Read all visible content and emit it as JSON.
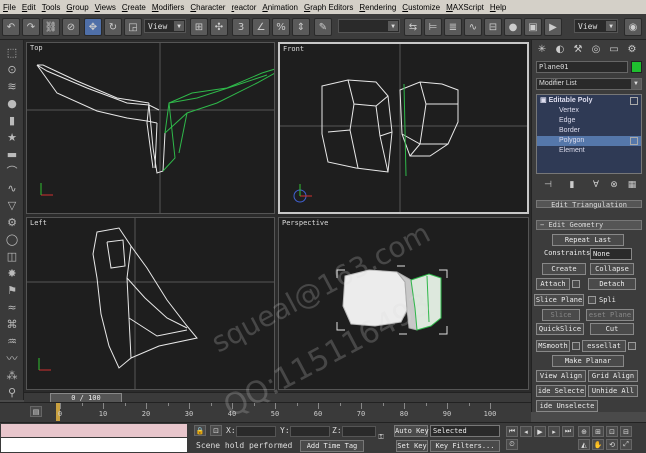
{
  "menu": [
    "File",
    "Edit",
    "Tools",
    "Group",
    "Views",
    "Create",
    "Modifiers",
    "Character",
    "reactor",
    "Animation",
    "Graph Editors",
    "Rendering",
    "Customize",
    "MAXScript",
    "Help"
  ],
  "toolbar": {
    "ref_coord": "View",
    "named_selection": "",
    "view2": "View"
  },
  "left_toolbar_icons": [
    "select-icon",
    "lathe-icon",
    "loft-icon",
    "sphere-icon",
    "cylinder-icon",
    "star-icon",
    "box-icon",
    "bend-icon",
    "wave-icon",
    "taper-icon",
    "gear-icon",
    "torus-icon",
    "camera-icon",
    "light-icon",
    "helper-icon",
    "space-warp-icon",
    "system-icon",
    "cloth-icon",
    "hair-icon",
    "particle-icon",
    "bone-icon"
  ],
  "viewports": {
    "top": "Top",
    "front": "Front",
    "left": "Left",
    "perspective": "Perspective"
  },
  "command_panel": {
    "object_name": "Plane01",
    "object_color": "#1fbf2f",
    "modifier_list": "Modifier List",
    "stack": {
      "root": "Editable Poly",
      "items": [
        "Vertex",
        "Edge",
        "Border",
        "Polygon",
        "Element"
      ],
      "selected": "Polygon"
    },
    "rollouts": {
      "edit_triangulation": "Edit Triangulation",
      "edit_geometry": "Edit Geometry"
    },
    "buttons": {
      "repeat_last": "Repeat Last",
      "constraints_label": "Constraints:",
      "constraints_value": "None",
      "create": "Create",
      "collapse": "Collapse",
      "attach": "Attach",
      "detach": "Detach",
      "slice_plane": "Slice Plane",
      "split": "Spli",
      "slice": "Slice",
      "reset_plane": "eset Plane",
      "quickslice": "QuickSlice",
      "cut": "Cut",
      "msmooth": "MSmooth",
      "tessellate": "essellat",
      "make_planar": "Make Planar",
      "view_align": "View Align",
      "grid_align": "Grid Align",
      "hide_selected": "ide Selecte",
      "unhide_all": "Unhide All",
      "hide_unselected": "ide Unselecte"
    }
  },
  "timeline": {
    "frame_display": "0 / 100",
    "ticks": [
      "0",
      "10",
      "20",
      "30",
      "40",
      "50",
      "60",
      "70",
      "80",
      "90",
      "100"
    ],
    "current_frame": 0
  },
  "status": {
    "prompt": "Scene hold performed",
    "add_time_tag": "Add Time Tag",
    "x_label": "X:",
    "y_label": "Y:",
    "z_label": "Z:",
    "auto_key": "Auto Key",
    "selected": "Selected",
    "set_key": "Set Key",
    "key_filters": "Key Filters..."
  },
  "watermark": {
    "line1": "squeal@163.com",
    "line2": "QQ:115116493"
  }
}
